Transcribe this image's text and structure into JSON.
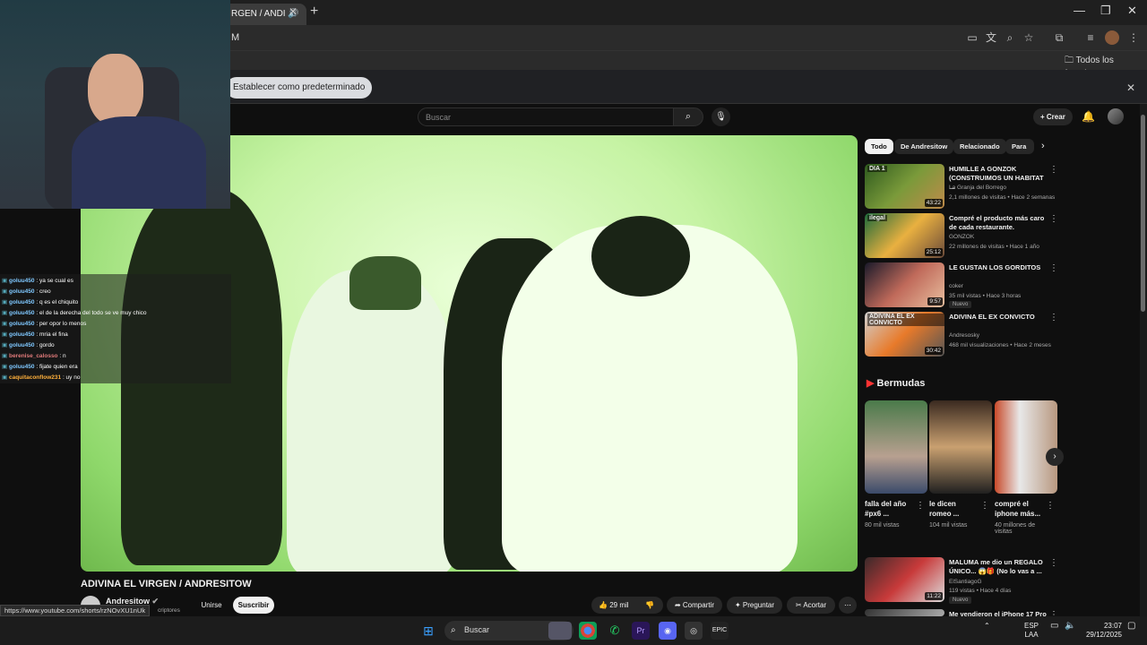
{
  "browser": {
    "tab_title": "RGEN / ANDI",
    "url_fragment": "M",
    "favorites_label": "Todos los favoritos",
    "infobar_button": "Establecer como predeterminado"
  },
  "header": {
    "search_placeholder": "Buscar",
    "create_label": "Crear"
  },
  "video": {
    "title": "ADIVINA EL VIRGEN / ANDRESITOW",
    "channel": "Andresitow",
    "subscribers_fragment": "criptores",
    "join_label": "Unirse",
    "subscribe_label": "Suscribir",
    "likes": "29 mil",
    "share_label": "Compartir",
    "ask_label": "Preguntar",
    "clip_label": "Acortar"
  },
  "chat": [
    {
      "user": "goluu450",
      "msg": ": ya se cual es",
      "color": "u"
    },
    {
      "user": "goluu450",
      "msg": ": creo",
      "color": "u"
    },
    {
      "user": "goluu450",
      "msg": ": q es el chiquito",
      "color": "u"
    },
    {
      "user": "goluu450",
      "msg": ": el de la derecha del todo se ve muy chico",
      "color": "u"
    },
    {
      "user": "goluu450",
      "msg": ": per opor lo menos",
      "color": "u"
    },
    {
      "user": "goluu450",
      "msg": ": mria el fina",
      "color": "u"
    },
    {
      "user": "goluu450",
      "msg": ": gordo",
      "color": "u"
    },
    {
      "user": "berenise_calosso",
      "msg": ": n",
      "color": "u2"
    },
    {
      "user": "goluu450",
      "msg": ": fijate quien era",
      "color": "u"
    },
    {
      "user": "caquitaconflow231",
      "msg": ": uy no",
      "color": "u3"
    }
  ],
  "sidebar": {
    "chips": [
      "Todo",
      "De Andresitow",
      "Relacionado",
      "Para t"
    ],
    "related": [
      {
        "title": "HUMILLE A GONZOK (CONSTRUIMOS UN HABITAT ...",
        "channel": "La Granja del Borrego",
        "meta": "2,1 millones de visitas • Hace 2 semanas",
        "duration": "43:22",
        "new": ""
      },
      {
        "title": "Compré el producto más caro de cada restaurante.",
        "channel": "GONZOK",
        "meta": "22 millones de visitas • Hace 1 año",
        "duration": "25:12",
        "new": ""
      },
      {
        "title": "LE GUSTAN LOS GORDITOS",
        "channel": "coker",
        "meta": "35 mil vistas • Hace 3 horas",
        "duration": "9:57",
        "new": "Nuevo"
      },
      {
        "title": "ADIVINA EL EX CONVICTO",
        "channel": "Andresosky",
        "meta": "468 mil visualizaciones • Hace 2 meses",
        "duration": "30:42",
        "new": ""
      }
    ],
    "thumb_texts": [
      "DIA 1",
      "ilegal",
      "",
      "ADIVINA EL EX CONVICTO"
    ],
    "shorts_heading": "Bermudas",
    "shorts": [
      {
        "title": "falla del año #px6 ...",
        "views": "80 mil vistas"
      },
      {
        "title": "le dicen romeo ...",
        "views": "104 mil vistas"
      },
      {
        "title": "compré el iphone más...",
        "views": "40 millones de visitas"
      }
    ],
    "more": [
      {
        "title": "MALUMA me dio un REGALO ÚNICO... 😱🎁 (No lo vas a ...",
        "channel": "ElSantiagoG",
        "meta": "119 vistas • Hace 4 días",
        "duration": "11:22",
        "new": "Nuevo"
      },
      {
        "title": "Me vendieron el iPhone 17 Pro",
        "channel": "",
        "meta": "",
        "duration": "",
        "new": ""
      }
    ]
  },
  "status_url": "https://www.youtube.com/shorts/rzNOvXU1nUk",
  "taskbar": {
    "search_label": "Buscar",
    "lang_top": "ESP",
    "lang_bottom": "LAA",
    "time": "23:07",
    "date": "29/12/2025"
  }
}
